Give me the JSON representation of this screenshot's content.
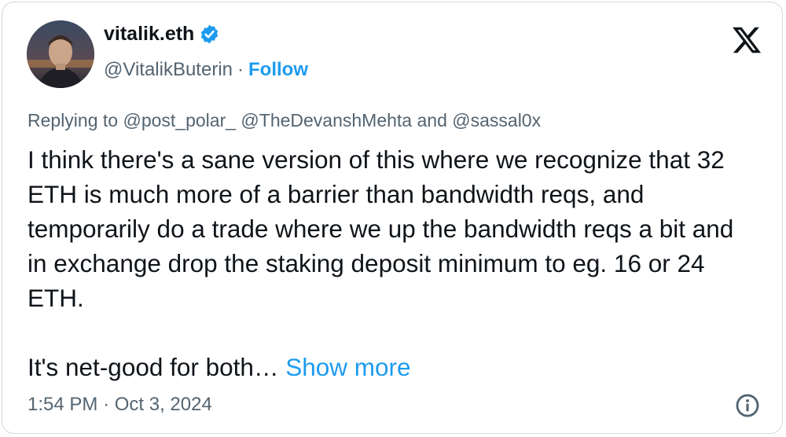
{
  "author": {
    "name": "vitalik.eth",
    "handle": "@VitalikButerin",
    "separator": "·",
    "follow_label": "Follow",
    "verified_icon": "verified-badge-icon"
  },
  "reply": {
    "prefix": "Replying to",
    "mention_1": "@post_polar_",
    "mention_2": "@TheDevanshMehta",
    "joiner": "and",
    "mention_3": "@sassal0x"
  },
  "tweet": {
    "paragraph_1": "I think there's a sane version of this where we recognize that 32 ETH is much more of a barrier than bandwidth reqs, and temporarily do a trade where we up the bandwidth reqs a bit and in exchange drop the staking deposit minimum to eg. 16 or 24 ETH.",
    "paragraph_2": "It's net-good for both…",
    "show_more": "Show more"
  },
  "meta": {
    "time": "1:54 PM",
    "separator": "·",
    "date": "Oct 3, 2024"
  },
  "icons": {
    "platform_logo": "x-logo-icon",
    "info": "info-icon"
  },
  "colors": {
    "accent": "#1d9bf0",
    "text": "#0f1419",
    "secondary": "#536471",
    "border": "#cfd9de"
  }
}
